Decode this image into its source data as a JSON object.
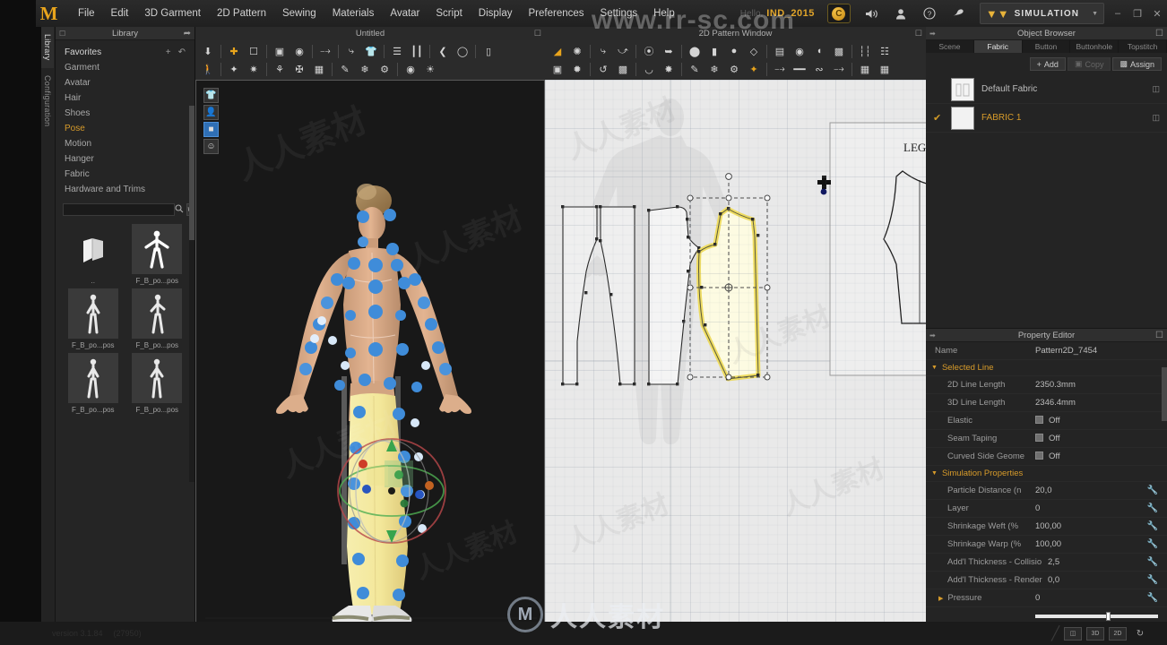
{
  "app": {
    "logo": "M",
    "menu": [
      "File",
      "Edit",
      "3D Garment",
      "2D Pattern",
      "Sewing",
      "Materials",
      "Avatar",
      "Script",
      "Display",
      "Preferences",
      "Settings",
      "Help"
    ],
    "hello_label": "Hello,",
    "user_id": "IND_2015",
    "coin_glyph": "C",
    "mode_label": "SIMULATION",
    "win_min": "–",
    "win_max": "❐",
    "win_close": "✕"
  },
  "vtabs": [
    {
      "label": "Library",
      "active": true
    },
    {
      "label": "Configuration",
      "active": false
    }
  ],
  "library": {
    "title": "Library",
    "items": [
      {
        "label": "Favorites",
        "state": "fav"
      },
      {
        "label": "Garment",
        "state": ""
      },
      {
        "label": "Avatar",
        "state": ""
      },
      {
        "label": "Hair",
        "state": ""
      },
      {
        "label": "Shoes",
        "state": ""
      },
      {
        "label": "Pose",
        "state": "active"
      },
      {
        "label": "Motion",
        "state": ""
      },
      {
        "label": "Hanger",
        "state": ""
      },
      {
        "label": "Fabric",
        "state": ""
      },
      {
        "label": "Hardware and Trims",
        "state": ""
      }
    ],
    "fav_add": "+",
    "fav_back": "↶",
    "search_value": "",
    "search_placeholder": "",
    "thumbs": [
      {
        "label": "..",
        "kind": "folder"
      },
      {
        "label": "F_B_po...pos",
        "kind": "pose"
      },
      {
        "label": "F_B_po...pos",
        "kind": "pose"
      },
      {
        "label": "F_B_po...pos",
        "kind": "pose"
      },
      {
        "label": "F_B_po...pos",
        "kind": "pose"
      },
      {
        "label": "F_B_po...pos",
        "kind": "pose"
      }
    ]
  },
  "viewport3d": {
    "title": "Untitled",
    "view_modes": [
      "garment-icon",
      "avatar-icon",
      "fabric-icon",
      "face-icon"
    ],
    "selected_view_mode_index": 2
  },
  "viewport2d": {
    "title": "2D Pattern Window",
    "pattern_label": "LEGG",
    "selected_pattern": "yellow"
  },
  "object_browser": {
    "title": "Object Browser",
    "tabs": [
      "Scene",
      "Fabric",
      "Button",
      "Buttonhole",
      "Topstitch"
    ],
    "active_tab": "Fabric",
    "buttons": {
      "add": "Add",
      "copy": "Copy",
      "assign": "Assign"
    },
    "fabrics": [
      {
        "name": "Default Fabric",
        "checked": false
      },
      {
        "name": "FABRIC 1",
        "checked": true
      }
    ]
  },
  "property_editor": {
    "title": "Property Editor",
    "name_key": "Name",
    "name_value": "Pattern2D_7454",
    "sections": [
      {
        "title": "Selected Line",
        "rows": [
          {
            "k": "2D Line Length",
            "v": "2350.3mm",
            "type": "text"
          },
          {
            "k": "3D Line Length",
            "v": "2346.4mm",
            "type": "text"
          },
          {
            "k": "Elastic",
            "v": "Off",
            "type": "check"
          },
          {
            "k": "Seam Taping",
            "v": "Off",
            "type": "check"
          },
          {
            "k": "Curved Side Geome",
            "v": "Off",
            "type": "check"
          }
        ]
      },
      {
        "title": "Simulation Properties",
        "rows": [
          {
            "k": "Particle Distance (n",
            "v": "20,0",
            "type": "tool"
          },
          {
            "k": "Layer",
            "v": "0",
            "type": "tool"
          },
          {
            "k": "Shrinkage Weft (%",
            "v": "100,00",
            "type": "tool"
          },
          {
            "k": "Shrinkage Warp (%",
            "v": "100,00",
            "type": "tool"
          },
          {
            "k": "Add'l Thickness - Collisio",
            "v": "2,5",
            "type": "tool"
          },
          {
            "k": "Add'l Thickness - Render",
            "v": "0,0",
            "type": "tool"
          },
          {
            "k": "Pressure",
            "v": "0",
            "type": "pressure"
          }
        ]
      }
    ]
  },
  "bottom": {
    "version": "version 3.1.84",
    "build": "(27950)",
    "view_buttons": [
      "split-view",
      "3D",
      "2D",
      "reset-view"
    ]
  },
  "watermarks": {
    "url": "www.rr-sc.com",
    "brand_cn": "人人素材",
    "brand_mark": "M"
  },
  "colors": {
    "accent": "#d79b2a",
    "highlight": "#e8a41c",
    "selection_yellow": "#f5e67a",
    "marker_blue": "#3d8ad8",
    "panel_bg": "#242424"
  }
}
